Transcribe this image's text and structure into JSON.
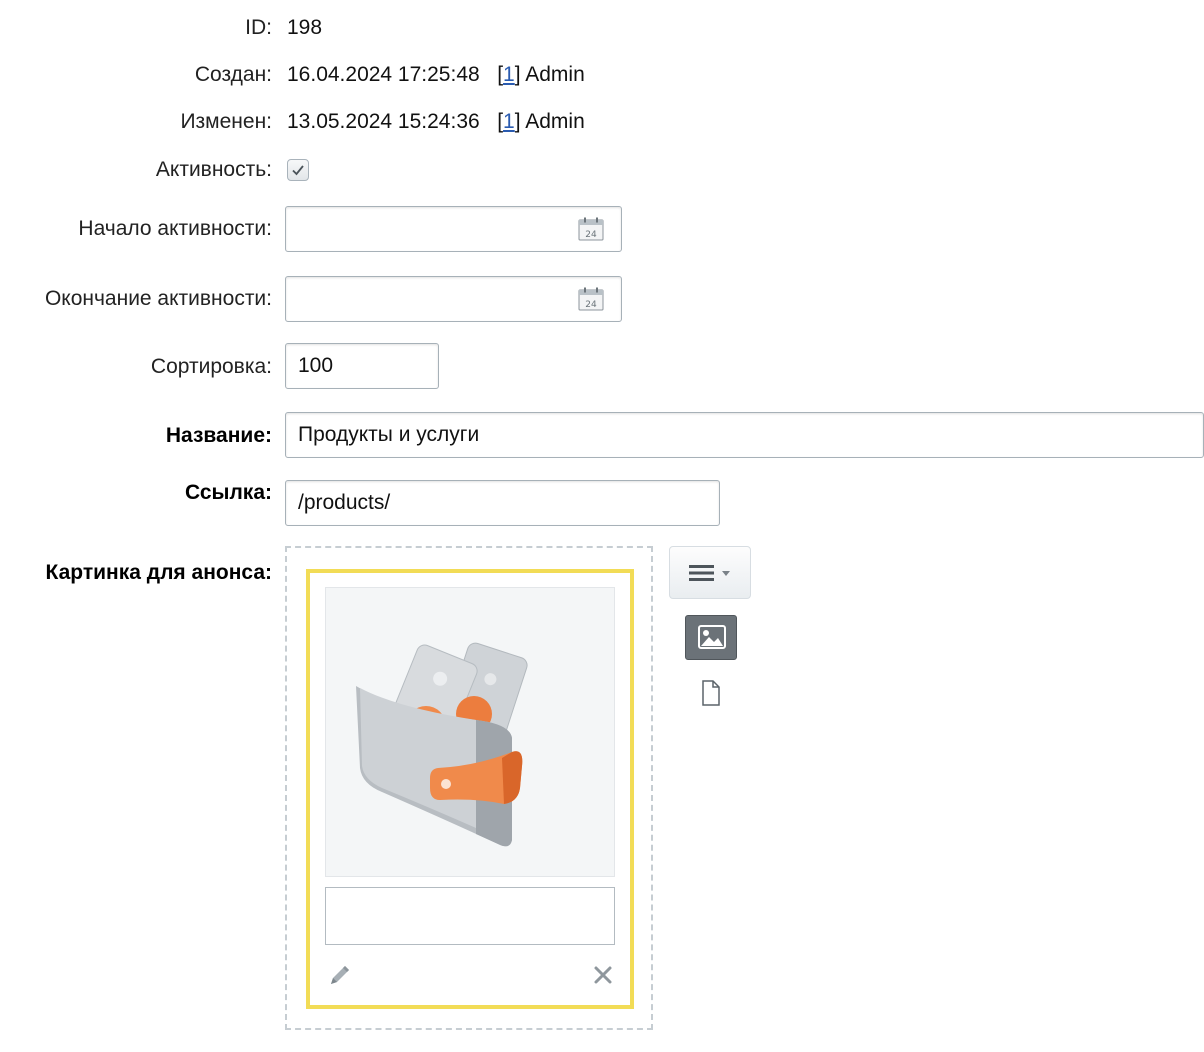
{
  "form": {
    "id": {
      "label": "ID:",
      "value": "198"
    },
    "created": {
      "label": "Создан:",
      "datetime": "16.04.2024 17:25:48",
      "user_id": "1",
      "user_name": "Admin"
    },
    "modified": {
      "label": "Изменен:",
      "datetime": "13.05.2024 15:24:36",
      "user_id": "1",
      "user_name": "Admin"
    },
    "active": {
      "label": "Активность:",
      "checked": true
    },
    "active_from": {
      "label": "Начало активности:",
      "value": ""
    },
    "active_to": {
      "label": "Окончание активности:",
      "value": ""
    },
    "sort": {
      "label": "Сортировка:",
      "value": "100"
    },
    "name": {
      "label": "Название:",
      "value": "Продукты и услуги"
    },
    "link": {
      "label": "Ссылка:",
      "value": "/products/"
    },
    "preview_picture": {
      "label": "Картинка для анонса:",
      "description": ""
    }
  },
  "icons": {
    "calendar": "calendar-icon",
    "menu": "menu-icon",
    "image": "image-icon",
    "file": "file-icon",
    "edit": "pencil-icon",
    "delete": "close-icon",
    "preview": "wallet-image"
  },
  "colors": {
    "card_border": "#f2dc56",
    "link": "#2a5bb0",
    "wallet_accent": "#f08a4b"
  }
}
